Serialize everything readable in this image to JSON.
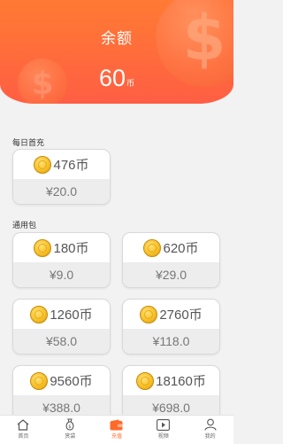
{
  "header": {
    "title": "余额",
    "balance_value": "60",
    "balance_unit": "币"
  },
  "daily": {
    "label": "每日首充",
    "packs": [
      {
        "coins": "476币",
        "price": "¥20.0"
      }
    ]
  },
  "general": {
    "label": "通用包",
    "packs": [
      {
        "coins": "180币",
        "price": "¥9.0"
      },
      {
        "coins": "620币",
        "price": "¥29.0"
      },
      {
        "coins": "1260币",
        "price": "¥58.0"
      },
      {
        "coins": "2760币",
        "price": "¥118.0"
      },
      {
        "coins": "9560币",
        "price": "¥388.0"
      },
      {
        "coins": "18160币",
        "price": "¥698.0"
      }
    ]
  },
  "tabbar": {
    "items": [
      {
        "label": "首页",
        "icon": "home-icon"
      },
      {
        "label": "赏袋",
        "icon": "money-bag-icon"
      },
      {
        "label": "充值",
        "icon": "wallet-icon"
      },
      {
        "label": "视频",
        "icon": "play-icon"
      },
      {
        "label": "我的",
        "icon": "user-icon"
      }
    ],
    "active": "充值"
  },
  "colors": {
    "accent": "#ff6a2a",
    "header_start": "#ff7a33",
    "header_end": "#ff5e43"
  }
}
